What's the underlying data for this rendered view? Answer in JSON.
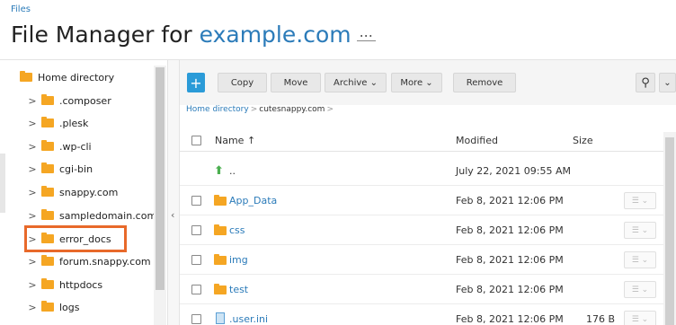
{
  "breadcrumb_top": "Files",
  "title": {
    "prefix": "File Manager for ",
    "domain": "example.com",
    "more": "..."
  },
  "tree": {
    "items": [
      {
        "label": "Home directory",
        "root": true
      },
      {
        "label": ".composer"
      },
      {
        "label": ".plesk"
      },
      {
        "label": ".wp-cli"
      },
      {
        "label": "cgi-bin"
      },
      {
        "label": "snappy.com"
      },
      {
        "label": "sampledomain.com"
      },
      {
        "label": "error_docs"
      },
      {
        "label": "forum.snappy.com"
      },
      {
        "label": "httpdocs"
      },
      {
        "label": "logs"
      }
    ],
    "chevron": ">",
    "collapse": "‹"
  },
  "toolbar": {
    "add": "+",
    "copy": "Copy",
    "move": "Move",
    "archive": "Archive ⌄",
    "more": "More ⌄",
    "remove": "Remove",
    "search_icon": "⚲",
    "dropdown_icon": "⌄"
  },
  "path": {
    "home": "Home directory",
    "sep": ">",
    "current": "cutesnappy.com",
    "tail": ">"
  },
  "table": {
    "headers": {
      "name": "Name ↑",
      "modified": "Modified",
      "size": "Size"
    },
    "rows": [
      {
        "type": "up",
        "name": "..",
        "modified": "July 22, 2021 09:55 AM",
        "size": ""
      },
      {
        "type": "folder",
        "name": "App_Data",
        "modified": "Feb 8, 2021 12:06 PM",
        "size": ""
      },
      {
        "type": "folder",
        "name": "css",
        "modified": "Feb 8, 2021 12:06 PM",
        "size": ""
      },
      {
        "type": "folder",
        "name": "img",
        "modified": "Feb 8, 2021 12:06 PM",
        "size": ""
      },
      {
        "type": "folder",
        "name": "test",
        "modified": "Feb 8, 2021 12:06 PM",
        "size": ""
      },
      {
        "type": "file",
        "name": ".user.ini",
        "modified": "Feb 8, 2021 12:06 PM",
        "size": "176 B"
      }
    ],
    "row_menu": "☰ ⌄"
  },
  "colors": {
    "accent": "#2b7bb9",
    "folder": "#f5a623",
    "highlight": "#e8692a",
    "add_button": "#2b9bd8"
  }
}
